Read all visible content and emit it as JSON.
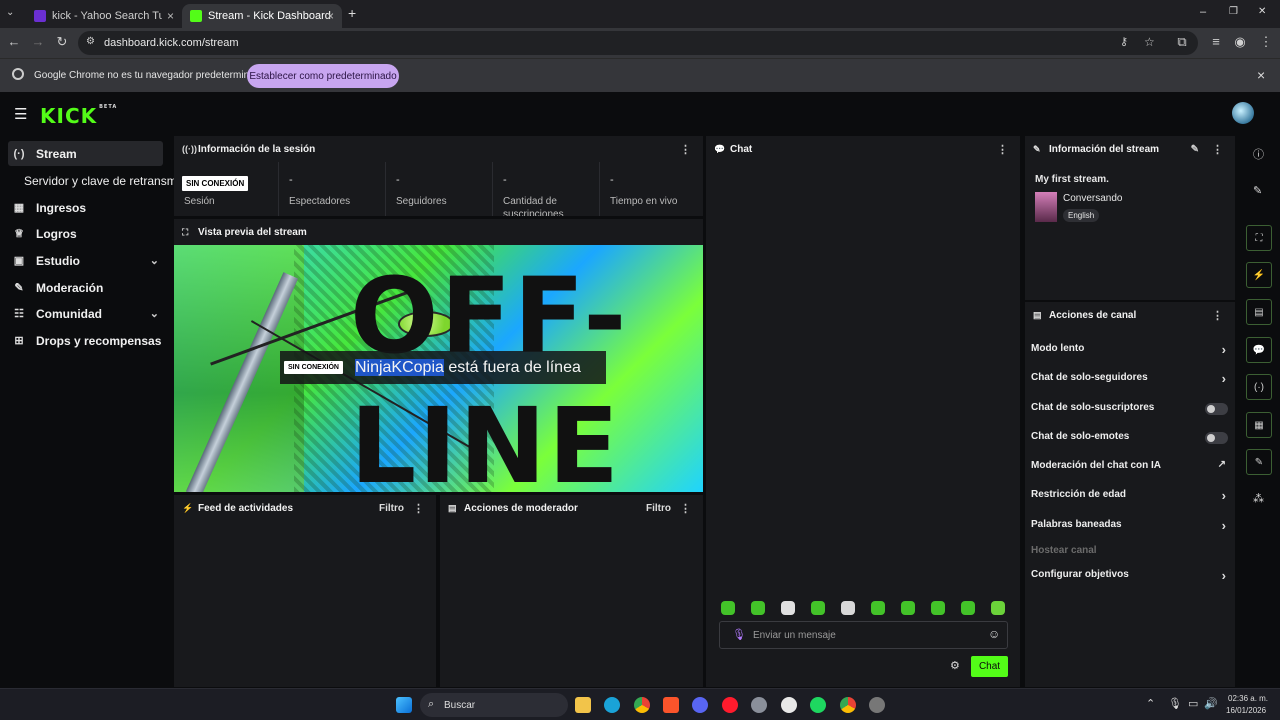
{
  "browser": {
    "tabs": [
      {
        "title": "kick - Yahoo Search Tus resultados",
        "close": "×"
      },
      {
        "title": "Stream - Kick Dashboard",
        "close": "×"
      }
    ],
    "new_tab": "+",
    "url": "dashboard.kick.com/stream",
    "infobar_message": "Google Chrome no es tu navegador predeterminado",
    "infobar_button": "Establecer como predeterminado",
    "infobar_close": "×",
    "window_controls": [
      "–",
      "❐",
      "✕"
    ]
  },
  "app": {
    "logo": "KICK",
    "logo_tag": "BETA",
    "sidebar": [
      {
        "label": "Stream",
        "icon": "(·)",
        "active": true
      },
      {
        "label": "Servidor y clave de retransmisión"
      },
      {
        "label": "Ingresos",
        "icon": "▦"
      },
      {
        "label": "Logros",
        "icon": "♕"
      },
      {
        "label": "Estudio",
        "icon": "▣",
        "expandable": true
      },
      {
        "label": "Moderación",
        "icon": "✎"
      },
      {
        "label": "Comunidad",
        "icon": "☷",
        "expandable": true
      },
      {
        "label": "Drops y recompensas",
        "icon": "⊞"
      }
    ],
    "session": {
      "title": "Información de la sesión",
      "status_badge": "SIN CONEXIÓN",
      "status_label": "Sesión",
      "stats": [
        {
          "value": "-",
          "label": "Espectadores"
        },
        {
          "value": "-",
          "label": "Seguidores"
        },
        {
          "value": "-",
          "label": "Cantidad de suscripciones"
        },
        {
          "value": "-",
          "label": "Tiempo en vivo"
        }
      ]
    },
    "preview": {
      "title": "Vista previa del stream",
      "badge": "SIN CONEXIÓN",
      "channel": "NinjaKCopia",
      "offline_text": " está fuera de línea",
      "art_top": "OFF-",
      "art_bottom": "LINE"
    },
    "activity_feed": {
      "title": "Feed de actividades",
      "filter": "Filtro"
    },
    "mod_actions": {
      "title": "Acciones de moderador",
      "filter": "Filtro"
    },
    "chat": {
      "title": "Chat",
      "placeholder": "Enviar un mensaje",
      "send_button": "Chat"
    },
    "stream_info": {
      "title": "Información del stream",
      "stream_title": "My first stream.",
      "category": "Conversando",
      "language": "English"
    },
    "channel_actions": {
      "title": "Acciones de canal",
      "items": [
        {
          "label": "Modo lento",
          "control": "arrow"
        },
        {
          "label": "Chat de solo-seguidores",
          "control": "arrow"
        },
        {
          "label": "Chat de solo-suscriptores",
          "control": "toggle",
          "on": false
        },
        {
          "label": "Chat de solo-emotes",
          "control": "toggle",
          "on": false
        },
        {
          "label": "Moderación del chat con IA",
          "control": "external"
        },
        {
          "label": "Restricción de edad",
          "control": "arrow"
        },
        {
          "label": "Palabras baneadas",
          "control": "arrow"
        },
        {
          "label": "Hostear canal",
          "control": "none",
          "disabled": true
        },
        {
          "label": "Configurar objetivos",
          "control": "arrow"
        }
      ]
    }
  },
  "taskbar": {
    "search": "Buscar",
    "time": "02:36 a. m.",
    "date": "16/01/2026"
  },
  "colors": {
    "accent": "#53fc18",
    "panel": "#18191c",
    "background": "#0b0c0e"
  }
}
